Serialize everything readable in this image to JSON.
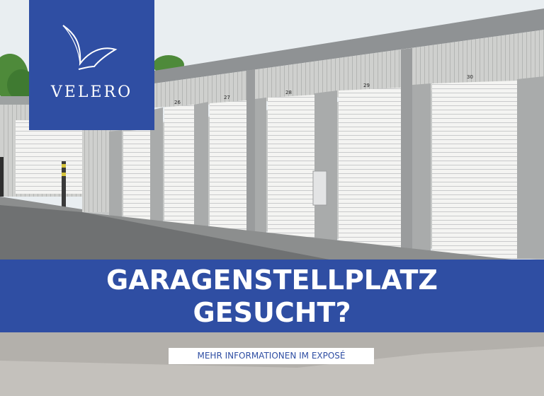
{
  "logo": {
    "icon": "bird-icon",
    "brand": "VELERO",
    "background_color": "#2f4ea3"
  },
  "banner": {
    "line1": "GARAGENSTELLPLATZ",
    "line2": "GESUCHT?",
    "background_color": "#2f4ea3"
  },
  "cta": {
    "label": "MEHR INFORMATIONEN IM EXPOSÉ"
  },
  "photo": {
    "door_numbers": [
      "26",
      "27",
      "28",
      "29",
      "30"
    ]
  }
}
